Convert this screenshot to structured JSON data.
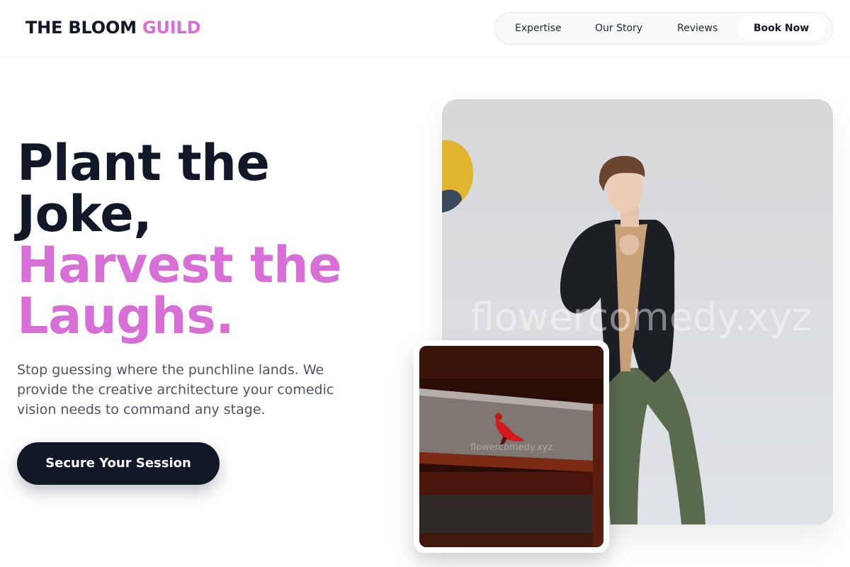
{
  "brand": {
    "part1": "THE BLOOM",
    "part2": "GUILD"
  },
  "nav": {
    "items": [
      {
        "label": "Expertise"
      },
      {
        "label": "Our Story"
      },
      {
        "label": "Reviews"
      }
    ],
    "cta_label": "Book Now"
  },
  "hero": {
    "headline_line1": "Plant the",
    "headline_line2": "Joke,",
    "headline_line3": "Harvest the",
    "headline_line4": "Laughs.",
    "lead": "Stop guessing where the punchline lands. We provide the creative architecture your comedic vision needs to command any stage.",
    "cta_label": "Secure Your Session"
  },
  "images": {
    "main_watermark": "flowercomedy.xyz",
    "small_watermark": "flowercomedy.xyz"
  },
  "colors": {
    "accent": "#d86fd6",
    "dark": "#111827",
    "text_muted": "#4b5563"
  }
}
